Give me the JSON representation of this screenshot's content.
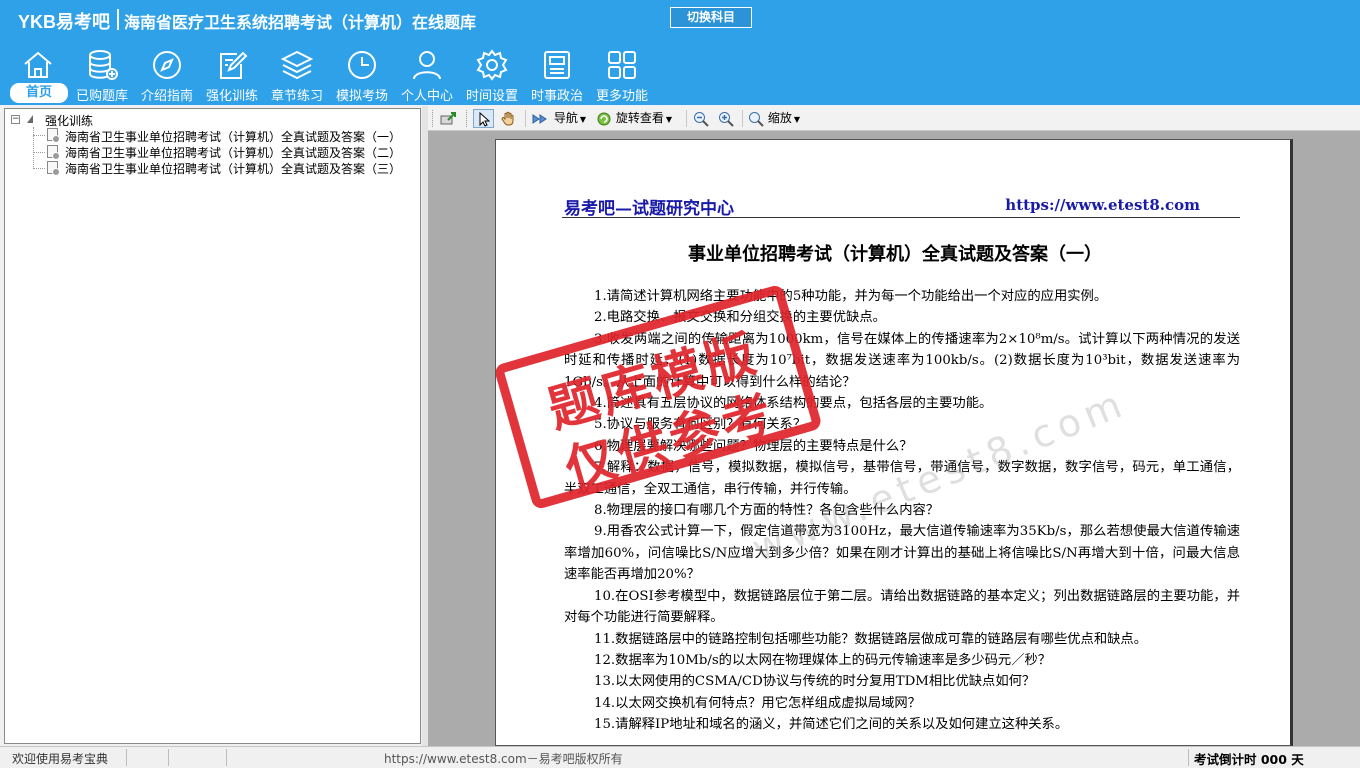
{
  "header": {
    "logo": "YKB易考吧",
    "title": "海南省医疗卫生系统招聘考试（计算机）在线题库",
    "switch_button": "切换科目",
    "nav": [
      {
        "label": "首页",
        "icon": "home-icon"
      },
      {
        "label": "已购题库",
        "icon": "database-icon"
      },
      {
        "label": "介绍指南",
        "icon": "compass-icon"
      },
      {
        "label": "强化训练",
        "icon": "edit-icon"
      },
      {
        "label": "章节练习",
        "icon": "layers-icon"
      },
      {
        "label": "模拟考场",
        "icon": "clock-icon"
      },
      {
        "label": "个人中心",
        "icon": "user-icon"
      },
      {
        "label": "时间设置",
        "icon": "gear-icon"
      },
      {
        "label": "时事政治",
        "icon": "news-icon"
      },
      {
        "label": "更多功能",
        "icon": "grid-icon"
      }
    ],
    "active_nav": "首页"
  },
  "tree": {
    "root": "强化训练",
    "items": [
      "海南省卫生事业单位招聘考试（计算机）全真试题及答案（一）",
      "海南省卫生事业单位招聘考试（计算机）全真试题及答案（二）",
      "海南省卫生事业单位招聘考试（计算机）全真试题及答案（三）"
    ]
  },
  "viewer_toolbar": {
    "nav_label": "导航",
    "rotate_label": "旋转查看",
    "zoom_label": "缩放"
  },
  "document": {
    "header_left": "易考吧—试题研究中心",
    "header_right": "https://www.etest8.com",
    "title": "事业单位招聘考试（计算机）全真试题及答案（一）",
    "questions": [
      "1.请简述计算机网络主要功能中的5种功能，并为每一个功能给出一个对应的应用实例。",
      "2.电路交换、报文交换和分组交换的主要优缺点。",
      "3.收发两端之间的传输距离为1000km，信号在媒体上的传播速率为2×10⁸m/s。试计算以下两种情况的发送时延和传播时延：(1)数据长度为10⁷bit，数据发送速率为100kb/s。(2)数据长度为10³bit，数据发送速率为1Gb/s。从上面的计算中可以得到什么样的结论？",
      "4.简述具有五层协议的网络体系结构的要点，包括各层的主要功能。",
      "5.协议与服务有何区别？有何关系？",
      "6.物理层要解决哪些问题？物理层的主要特点是什么？",
      "7.解释：数据，信号，模拟数据，模拟信号，基带信号，带通信号，数字数据，数字信号，码元，单工通信，半双工通信，全双工通信，串行传输，并行传输。",
      "8.物理层的接口有哪几个方面的特性？各包含些什么内容？",
      "9.用香农公式计算一下，假定信道带宽为3100Hz，最大信道传输速率为35Kb/s，那么若想使最大信道传输速率增加60%，问信噪比S/N应增大到多少倍？如果在刚才计算出的基础上将信噪比S/N再增大到十倍，问最大信息速率能否再增加20%？",
      "10.在OSI参考模型中，数据链路层位于第二层。请给出数据链路的基本定义；列出数据链路层的主要功能，并对每个功能进行简要解释。",
      "11.数据链路层中的链路控制包括哪些功能？数据链路层做成可靠的链路层有哪些优点和缺点。",
      "12.数据率为10Mb/s的以太网在物理媒体上的码元传输速率是多少码元／秒？",
      "13.以太网使用的CSMA/CD协议与传统的时分复用TDM相比优缺点如何？",
      "14.以太网交换机有何特点？用它怎样组成虚拟局域网？",
      "15.请解释IP地址和域名的涵义，并简述它们之间的关系以及如何建立这种关系。"
    ],
    "stamp_line1": "题库模版",
    "stamp_line2": "仅供参考",
    "watermark": "www.etest8.com"
  },
  "status": {
    "left": "欢迎使用易考宝典",
    "center": "https://www.etest8.com－易考吧版权所有",
    "right": "考试倒计时 000 天"
  }
}
